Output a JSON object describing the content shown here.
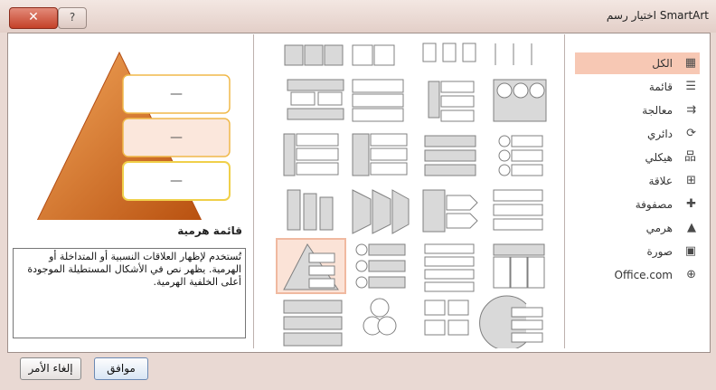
{
  "window": {
    "title": "اختيار رسم SmartArt",
    "close_glyph": "✕",
    "help_glyph": "?"
  },
  "categories": [
    {
      "label": "الكل",
      "icon": "grid-icon",
      "selected": true
    },
    {
      "label": "قائمة",
      "icon": "list-icon"
    },
    {
      "label": "معالجة",
      "icon": "process-icon"
    },
    {
      "label": "دائري",
      "icon": "cycle-icon"
    },
    {
      "label": "هيكلي",
      "icon": "hierarchy-icon"
    },
    {
      "label": "علاقة",
      "icon": "relationship-icon"
    },
    {
      "label": "مصفوفة",
      "icon": "matrix-icon"
    },
    {
      "label": "هرمي",
      "icon": "pyramid-icon"
    },
    {
      "label": "صورة",
      "icon": "picture-icon"
    },
    {
      "label": "Office.com",
      "icon": "globe-icon"
    }
  ],
  "preview": {
    "title": "قائمة هرمية",
    "description": "تُستخدم لإظهار العلاقات النسبية أو المتداخلة أو الهرمية. يظهر نص في الأشكال المستطيلة الموجودة أعلى الخلفية الهرمية.",
    "dash": "—"
  },
  "gallery": {
    "selected_index": 16
  },
  "buttons": {
    "ok": "موافق",
    "cancel": "إلغاء الأمر"
  },
  "colors": {
    "accent": "#f7c8b4",
    "pyramid": "#d9691f",
    "box_border": "#f0b94a"
  }
}
